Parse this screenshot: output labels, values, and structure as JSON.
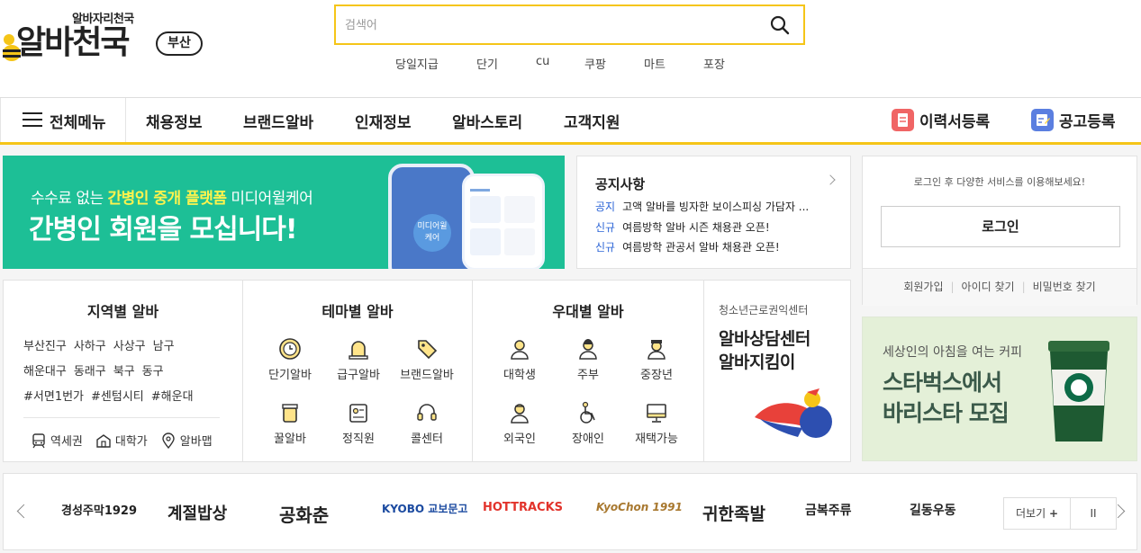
{
  "header": {
    "logo_sub": "알바자리천국",
    "logo_main": "알바천국",
    "region": "부산",
    "search_placeholder": "검색어",
    "keywords": [
      "당일지급",
      "단기",
      "cu",
      "쿠팡",
      "마트",
      "포장"
    ]
  },
  "gnb": {
    "all_menu": "전체메뉴",
    "items": [
      "채용정보",
      "브랜드알바",
      "인재정보",
      "알바스토리",
      "고객지원"
    ],
    "resume": "이력서등록",
    "post": "공고등록"
  },
  "banner": {
    "line1_pre": "수수료 없는 ",
    "line1_hl": "간병인 중개 플랫폼",
    "line1_post": " 미디어윌케어",
    "line2": "간병인 회원을 모십니다!",
    "phone_label": "미디어윌 케어"
  },
  "notice": {
    "title": "공지사항",
    "rows": [
      {
        "tag": "공지",
        "text": "고액 알바를 빙자한 보이스피싱 가담자 ..."
      },
      {
        "tag": "신규",
        "text": "여름방학 알바 시즌 채용관 오픈!"
      },
      {
        "tag": "신규",
        "text": "여름방학 관공서 알바 채용관 오픈!"
      }
    ]
  },
  "login": {
    "desc": "로그인 후 다양한 서비스를 이용해보세요!",
    "button": "로그인",
    "links": [
      "회원가입",
      "아이디 찾기",
      "비밀번호 찾기"
    ]
  },
  "region": {
    "title": "지역별 알바",
    "row1": [
      "부산진구",
      "사하구",
      "사상구",
      "남구"
    ],
    "row2": [
      "해운대구",
      "동래구",
      "북구",
      "동구"
    ],
    "row3": [
      "#서면1번가",
      "#센텀시티",
      "#해운대"
    ],
    "tools": [
      "역세권",
      "대학가",
      "알바맵"
    ]
  },
  "theme": {
    "title": "테마별 알바",
    "items": [
      "단기알바",
      "급구알바",
      "브랜드알바",
      "꿀알바",
      "정직원",
      "콜센터"
    ]
  },
  "prefer": {
    "title": "우대별 알바",
    "items": [
      "대학생",
      "주부",
      "중장년",
      "외국인",
      "장애인",
      "재택가능"
    ]
  },
  "counsel": {
    "small": "청소년근로권익센터",
    "big1": "알바상담센터",
    "big2": "알바지킴이"
  },
  "ad2": {
    "line1": "세상인의 아침을 여는 커피",
    "line2": "스타벅스에서",
    "line3": "바리스타 모집"
  },
  "brands": {
    "logos": [
      "경성주막1929",
      "계절밥상",
      "공화춘",
      "KYOBO 교보문고",
      "HOTTRACKS",
      "KyoChon 1991",
      "귀한족발",
      "금복주류",
      "길동우동"
    ],
    "more": "더보기",
    "more_plus": "+",
    "pause": "II"
  },
  "colors": {
    "accent": "#f5c518",
    "banner_green": "#1dbf96",
    "notice_tag": "#2a63d6"
  }
}
